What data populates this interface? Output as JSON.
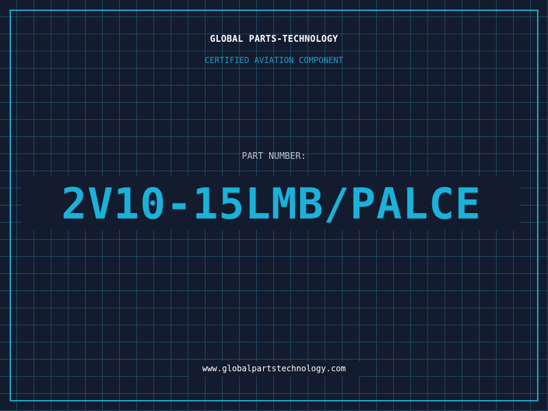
{
  "header": {
    "company": "GLOBAL PARTS-TECHNOLOGY",
    "tagline": "CERTIFIED AVIATION COMPONENT"
  },
  "part": {
    "label": "PART NUMBER:",
    "number": "2V10-15LMB/PALCE"
  },
  "footer": {
    "website": "www.globalpartstechnology.com"
  },
  "colors": {
    "background": "#131b2e",
    "grid": "#286e8c",
    "frame": "#1ba8cc",
    "accent": "#1bb1d9",
    "label": "#b8c2d0",
    "text": "#ffffff"
  }
}
